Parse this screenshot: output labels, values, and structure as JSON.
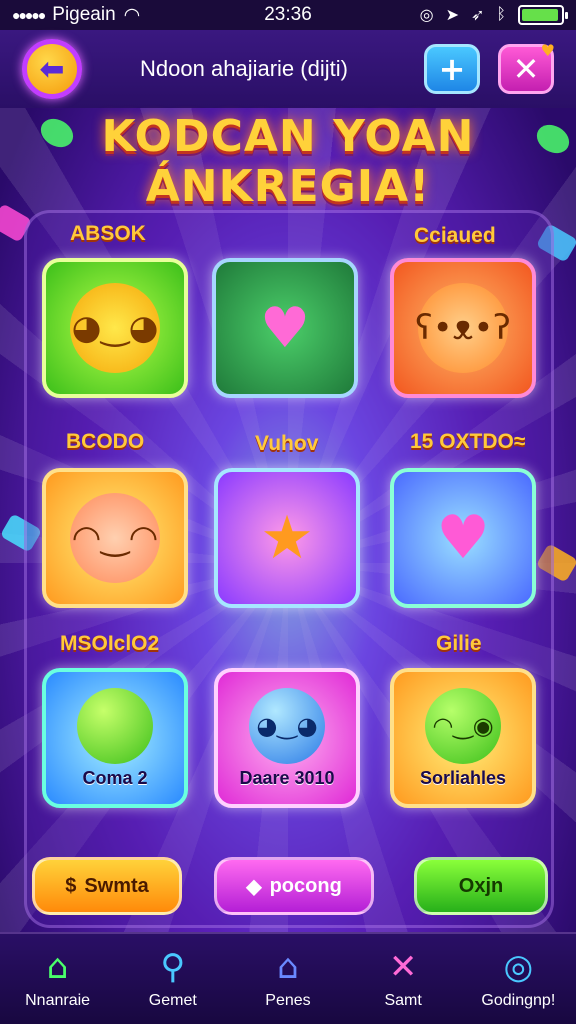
{
  "status": {
    "carrier": "Pigeain",
    "time": "23:36",
    "battery_level": 0.95
  },
  "header": {
    "title": "Ndoon ahajiarie (dijti)",
    "back_icon": "arrow-left-icon",
    "plus_icon": "plus-icon",
    "close_icon": "close-icon"
  },
  "banner": {
    "line1": "KODCAN YOAN",
    "line2": "ÁNKREGIA!"
  },
  "categories": {
    "row1_left": "ABSOK",
    "row1_right": "Cciaued",
    "row2_left": "BCODO",
    "row2_mid": "Vuhov",
    "row2_right": "15 OXTDO≈",
    "row3_left": "MSOIclO2",
    "row3_right": "Gilie"
  },
  "tiles": [
    {
      "name": "yellow-creature-tile",
      "caption": ""
    },
    {
      "name": "heart-board-tile",
      "caption": ""
    },
    {
      "name": "lion-cub-tile",
      "caption": ""
    },
    {
      "name": "girl-character-tile",
      "caption": ""
    },
    {
      "name": "orange-star-tile",
      "caption": ""
    },
    {
      "name": "pink-heart-tile",
      "caption": ""
    },
    {
      "name": "green-ball-tile",
      "caption": "Coma 2"
    },
    {
      "name": "globe-face-tile",
      "caption": "Daare 3010"
    },
    {
      "name": "green-smiley-tile",
      "caption": "Sorliahles"
    }
  ],
  "actions": {
    "left": "Swmta",
    "mid": "pocong",
    "right": "Oxjn"
  },
  "nav": [
    {
      "label": "Nnanraie",
      "icon": "home-icon"
    },
    {
      "label": "Gemet",
      "icon": "search-icon"
    },
    {
      "label": "Penes",
      "icon": "house-icon"
    },
    {
      "label": "Samt",
      "icon": "tools-icon"
    },
    {
      "label": "Godingnp!",
      "icon": "target-icon"
    }
  ],
  "colors": {
    "accent": "#ffd23a",
    "background": "#5a1fb8"
  }
}
